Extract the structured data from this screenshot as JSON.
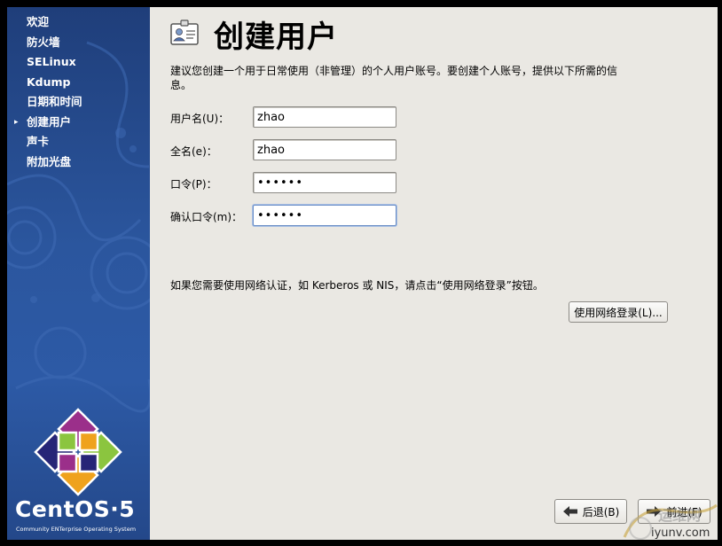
{
  "sidebar": {
    "steps": [
      {
        "label": "欢迎"
      },
      {
        "label": "防火墙"
      },
      {
        "label": "SELinux"
      },
      {
        "label": "Kdump"
      },
      {
        "label": "日期和时间"
      },
      {
        "label": "创建用户",
        "current": true
      },
      {
        "label": "声卡"
      },
      {
        "label": "附加光盘"
      }
    ],
    "current_marker": "▸",
    "brand": "CentOS·5",
    "tagline": "Community ENTerprise Operating System"
  },
  "page": {
    "title": "创建用户",
    "intro": "建议您创建一个用于日常使用（非管理）的个人用户账号。要创建个人账号，提供以下所需的信息。"
  },
  "form": {
    "username": {
      "label": "用户名(U)：",
      "value": "zhao"
    },
    "fullname": {
      "label": "全名(e)：",
      "value": "zhao"
    },
    "password": {
      "label": "口令(P)：",
      "value": "zhaozh"
    },
    "confirm": {
      "label": "确认口令(m)：",
      "value": "zhaozh"
    }
  },
  "network": {
    "text": "如果您需要使用网络认证，如 Kerberos 或 NIS，请点击“使用网络登录”按钮。",
    "button_label": "使用网络登录(L)..."
  },
  "nav": {
    "back_label": "后退(B)",
    "next_label": "前进(F)"
  },
  "watermark": {
    "text_main": "运维网",
    "text_url": "iyunv.com"
  },
  "colors": {
    "sidebar": "#2b569e",
    "panel": "#eae8e3",
    "logo_purple": "#9b2f8a",
    "logo_green": "#8bc53f",
    "logo_orange": "#efa21d",
    "logo_blue": "#262577"
  }
}
